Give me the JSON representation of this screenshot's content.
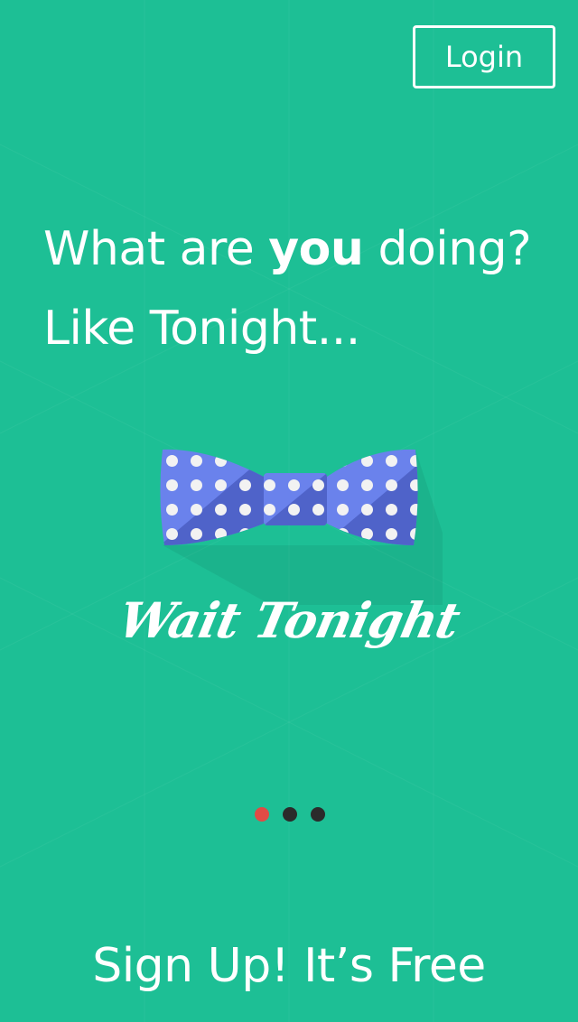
{
  "header": {
    "login_label": "Login"
  },
  "headline": {
    "line1_pre": "What are ",
    "line1_bold": "you",
    "line1_post": " doing?",
    "line2": "Like Tonight..."
  },
  "brand": {
    "logo_icon": "bow-tie-icon",
    "logo_text": "Wait Tonight"
  },
  "pager": {
    "total": 3,
    "active_index": 0,
    "active_color": "#e04b45",
    "inactive_color": "#2b2b2b"
  },
  "footer": {
    "signup_label": "Sign Up! It’s Free"
  },
  "colors": {
    "background": "#1dbf95",
    "bowtie": "#5b73e0"
  }
}
